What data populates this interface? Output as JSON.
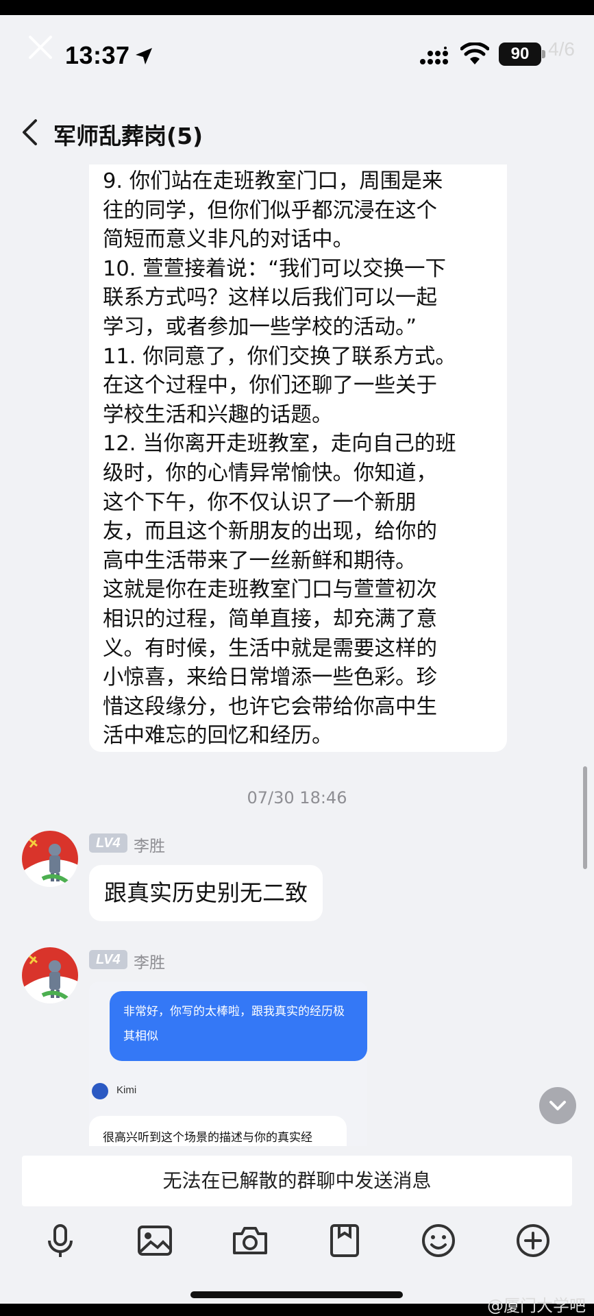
{
  "status_bar": {
    "time": "13:37",
    "battery": "90",
    "page_counter": "4/6"
  },
  "nav": {
    "title": "军师乱葬岗(5)"
  },
  "messages": {
    "long_text": "9. 你们站在走班教室门口，周围是来\n往的同学，但你们似乎都沉浸在这个\n简短而意义非凡的对话中。\n10. 萱萱接着说：“我们可以交换一下\n联系方式吗？这样以后我们可以一起\n学习，或者参加一些学校的活动。”\n11. 你同意了，你们交换了联系方式。\n在这个过程中，你们还聊了一些关于\n学校生活和兴趣的话题。\n12. 当你离开走班教室，走向自己的班\n级时，你的心情异常愉快。你知道，\n这个下午，你不仅认识了一个新朋\n友，而且这个新朋友的出现，给你的\n高中生活带来了一丝新鲜和期待。\n这就是你在走班教室门口与萱萱初次\n相识的过程，简单直接，却充满了意\n义。有时候，生活中就是需要这样的\n小惊喜，来给日常增添一些色彩。珍\n惜这段缘分，也许它会带给你高中生\n活中难忘的回忆和经历。",
    "timestamp": "07/30 18:46",
    "msg1": {
      "level": "LV4",
      "sender": "李胜",
      "text": "跟真实历史别无二致"
    },
    "msg2": {
      "level": "LV4",
      "sender": "李胜",
      "image_user_text": "非常好，你写的太棒啦，跟我真实的经历极其相似",
      "image_bot_name": "Kimi",
      "image_bot_text": "很高兴听到这个场景的描述与你的真实经"
    }
  },
  "bottom": {
    "disabled_notice": "无法在已解散的群聊中发送消息",
    "tools": [
      "microphone-icon",
      "image-icon",
      "camera-icon",
      "file-icon",
      "emoji-icon",
      "plus-icon"
    ]
  },
  "watermark": "@厦门大学吧",
  "colors": {
    "background": "#f1f2f5",
    "bubble": "#ffffff",
    "user_bubble_blue": "#3478f6"
  }
}
